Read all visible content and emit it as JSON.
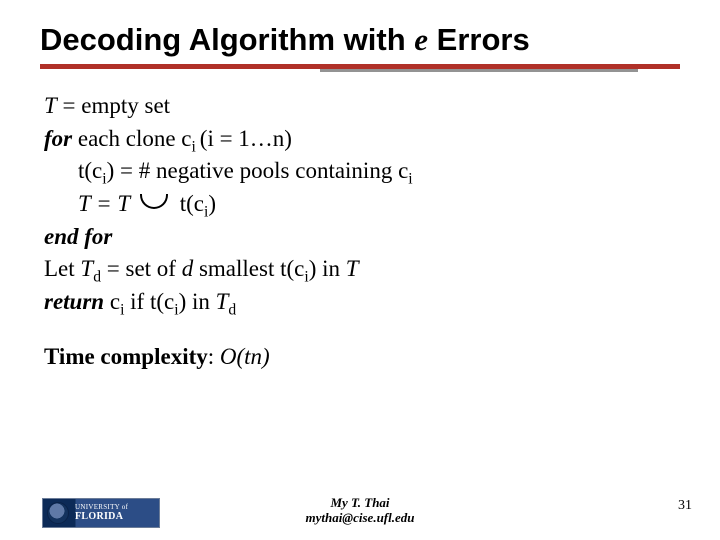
{
  "title": {
    "prefix": "Decoding Algorithm with ",
    "e": "e",
    "suffix": " Errors"
  },
  "algo": {
    "l1_a": "T",
    "l1_b": " = empty set",
    "l2_a": "for",
    "l2_b": " each clone c",
    "l2_sub": "i ",
    "l2_c": "(i = 1…n)",
    "l3_a": "t(c",
    "l3_sub1": "i",
    "l3_b": ") = # negative pools containing c",
    "l3_sub2": "i",
    "l4_a": "T = T",
    "l4_b": "t(c",
    "l4_sub": "i",
    "l4_c": ")",
    "l5": "end for",
    "l6_a": "Let ",
    "l6_b": "T",
    "l6_sub1": "d",
    "l6_c": " = set of ",
    "l6_d": "d",
    "l6_e": " smallest t(c",
    "l6_sub2": "i",
    "l6_f": ") in ",
    "l6_g": "T",
    "l7_a": "return",
    "l7_b": " c",
    "l7_sub1": "i",
    "l7_c": " if t(c",
    "l7_sub2": "i",
    "l7_d": ") in ",
    "l7_e": "T",
    "l7_sub3": "d"
  },
  "complexity": {
    "label": "Time complexity",
    "sep": ": ",
    "value": "O(tn)"
  },
  "footer": {
    "logo_line1": "UNIVERSITY of",
    "logo_line2": "FLORIDA",
    "author": "My T. Thai",
    "email": "mythai@cise.ufl.edu",
    "page": "31"
  }
}
